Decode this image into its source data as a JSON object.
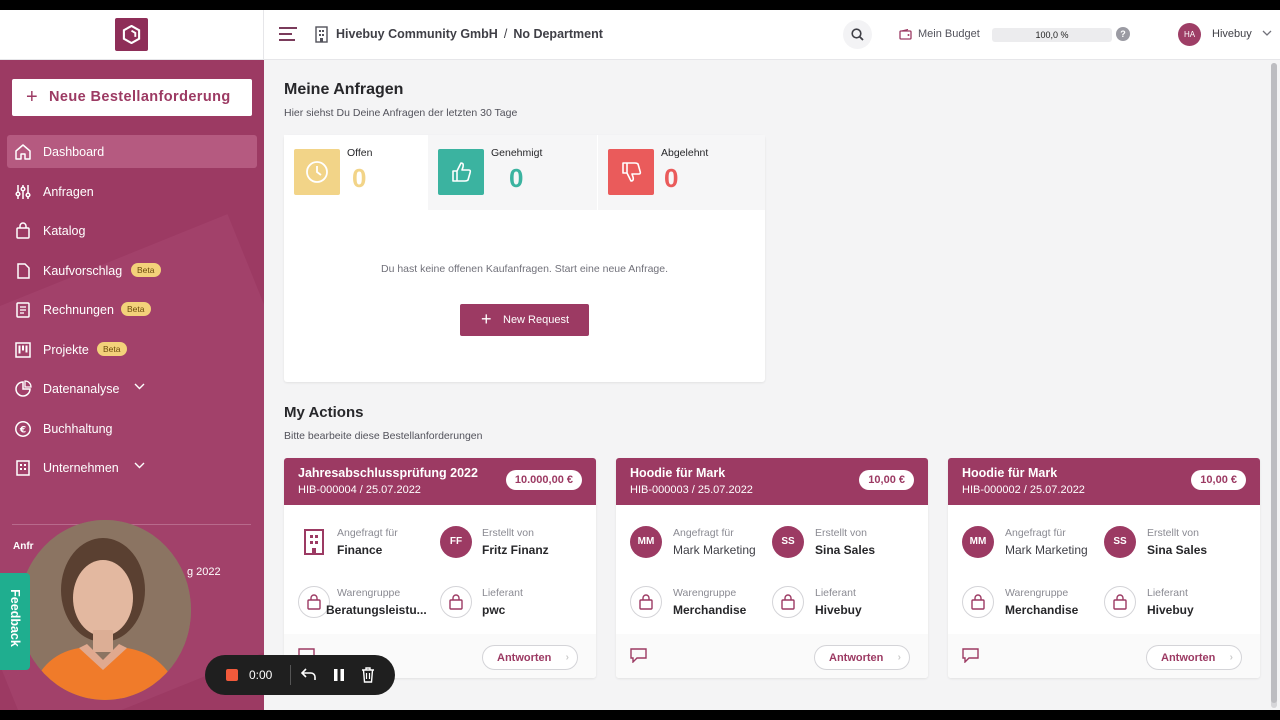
{
  "header": {
    "company": "Hivebuy Community GmbH",
    "separator": "/",
    "department": "No Department",
    "budget_label": "Mein Budget",
    "budget_value": "100,0 %",
    "budget_fraction": 1.0,
    "help": "?",
    "avatar_initials": "HA",
    "user_name": "Hivebuy"
  },
  "sidebar": {
    "new_request_button": "Neue Bestellanforderung",
    "items": [
      {
        "label": "Dashboard",
        "icon": "home-icon",
        "active": true
      },
      {
        "label": "Anfragen",
        "icon": "sliders-icon"
      },
      {
        "label": "Katalog",
        "icon": "shopping-bag-icon"
      },
      {
        "label": "Kaufvorschlag",
        "icon": "document-icon",
        "badge": "Beta"
      },
      {
        "label": "Rechnungen",
        "icon": "receipt-icon",
        "badge": "Beta"
      },
      {
        "label": "Projekte",
        "icon": "kanban-icon",
        "badge": "Beta"
      },
      {
        "label": "Datenanalyse",
        "icon": "pie-chart-icon",
        "expandable": true
      },
      {
        "label": "Buchhaltung",
        "icon": "euro-icon"
      },
      {
        "label": "Unternehmen",
        "icon": "building-icon",
        "expandable": true
      }
    ],
    "section_label": "Anfr",
    "section_item_partial": "g 2022"
  },
  "requests": {
    "title": "Meine Anfragen",
    "subtitle": "Hier siehst Du Deine Anfragen der letzten 30 Tage",
    "stats": [
      {
        "label": "Offen",
        "value": "0",
        "color": "#f2d488",
        "num_color": "#f2d488"
      },
      {
        "label": "Genehmigt",
        "value": "0",
        "color": "#3bb3a0",
        "num_color": "#3bb3a0"
      },
      {
        "label": "Abgelehnt",
        "value": "0",
        "color": "#ea5b5b",
        "num_color": "#ea5b5b"
      }
    ],
    "empty_message": "Du hast keine offenen Kaufanfragen. Start eine neue Anfrage.",
    "new_request_button": "New Request"
  },
  "actions": {
    "title": "My Actions",
    "subtitle": "Bitte bearbeite diese Bestellanforderungen",
    "cards": [
      {
        "title": "Jahresabschlussprüfung 2022",
        "id_date": "HIB-000004 / 25.07.2022",
        "price": "10.000,00 €",
        "requested_for_label": "Angefragt für",
        "requested_for": "Finance",
        "created_by_label": "Erstellt von",
        "created_by_initials": "FF",
        "created_by": "Fritz Finanz",
        "category_label": "Warengruppe",
        "category": "Beratungsleistu...",
        "supplier_label": "Lieferant",
        "supplier": "pwc",
        "reply_button": "Antworten"
      },
      {
        "title": "Hoodie für Mark",
        "id_date": "HIB-000003 / 25.07.2022",
        "price": "10,00 €",
        "requested_for_label": "Angefragt für",
        "requested_for_initials": "MM",
        "requested_for": "Mark Marketing",
        "created_by_label": "Erstellt von",
        "created_by_initials": "SS",
        "created_by": "Sina Sales",
        "category_label": "Warengruppe",
        "category": "Merchandise",
        "supplier_label": "Lieferant",
        "supplier": "Hivebuy",
        "reply_button": "Antworten"
      },
      {
        "title": "Hoodie für Mark",
        "id_date": "HIB-000002 / 25.07.2022",
        "price": "10,00 €",
        "requested_for_label": "Angefragt für",
        "requested_for_initials": "MM",
        "requested_for": "Mark Marketing",
        "created_by_label": "Erstellt von",
        "created_by_initials": "SS",
        "created_by": "Sina Sales",
        "category_label": "Warengruppe",
        "category": "Merchandise",
        "supplier_label": "Lieferant",
        "supplier": "Hivebuy",
        "reply_button": "Antworten"
      }
    ]
  },
  "overlay": {
    "feedback": "Feedback",
    "recorder_time": "0:00"
  },
  "colors": {
    "brand": "#9c3a63",
    "accent_green": "#1fae8f"
  }
}
